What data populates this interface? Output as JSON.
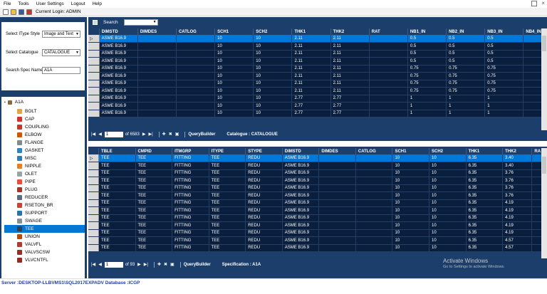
{
  "menu": [
    "File",
    "Tools",
    "User Settings",
    "Logout",
    "Help"
  ],
  "toolbar": {
    "login": "Current Login: ADMIN"
  },
  "filters": {
    "style_label": "Select IType Style",
    "style_value": "Image and Text",
    "catalogue_label": "Select Catalogue",
    "catalogue_value": "CATALOGUE",
    "spec_label": "Search Spec Name:",
    "spec_value": "A1A"
  },
  "tree": {
    "root": "A1A",
    "items": [
      {
        "label": "BOLT",
        "color": "#e8a33a"
      },
      {
        "label": "CAP",
        "color": "#d2342a"
      },
      {
        "label": "COUPLING",
        "color": "#c0392b"
      },
      {
        "label": "ELBOW",
        "color": "#d35400"
      },
      {
        "label": "FLANGE",
        "color": "#7f8c8d"
      },
      {
        "label": "GASKET",
        "color": "#2e86c1"
      },
      {
        "label": "MISC",
        "color": "#2980b9"
      },
      {
        "label": "NIPPLE",
        "color": "#e67e22"
      },
      {
        "label": "OLET",
        "color": "#95a5a6"
      },
      {
        "label": "PIPE",
        "color": "#e74c3c"
      },
      {
        "label": "PLUG",
        "color": "#a93226"
      },
      {
        "label": "REDUCER",
        "color": "#5d6d7e"
      },
      {
        "label": "RSETON_BR",
        "color": "#cb4335"
      },
      {
        "label": "SUPPORT",
        "color": "#2874a6"
      },
      {
        "label": "SWAGE",
        "color": "#839192"
      },
      {
        "label": "TEE",
        "color": "#2e4053"
      },
      {
        "label": "UNION",
        "color": "#ba4a00"
      },
      {
        "label": "VALVFL",
        "color": "#b03a2e"
      },
      {
        "label": "VALVSCSW",
        "color": "#943126"
      },
      {
        "label": "VLVCNTFL",
        "color": "#922b21"
      }
    ],
    "selected_index": 15
  },
  "grid1": {
    "search_label": "Search",
    "columns": [
      "DIMSTD",
      "DIMDES",
      "CATLOG",
      "SCH1",
      "SCH2",
      "THK1",
      "THK2",
      "RAT",
      "NB1_IN",
      "NB2_IN",
      "NB3_IN",
      "NB4_IN"
    ],
    "rows": [
      [
        "ASME B16.9",
        "",
        "",
        "10",
        "10",
        "2.11",
        "2.11",
        "",
        "0.5",
        "0.5",
        "0.5",
        ""
      ],
      [
        "ASME B16.9",
        "",
        "",
        "10",
        "10",
        "2.11",
        "2.11",
        "",
        "0.5",
        "0.5",
        "0.5",
        ""
      ],
      [
        "ASME B16.9",
        "",
        "",
        "10",
        "10",
        "2.11",
        "2.11",
        "",
        "0.5",
        "0.5",
        "0.5",
        ""
      ],
      [
        "ASME B16.9",
        "",
        "",
        "10",
        "10",
        "2.11",
        "2.11",
        "",
        "0.5",
        "0.5",
        "0.5",
        ""
      ],
      [
        "ASME B16.9",
        "",
        "",
        "10",
        "10",
        "2.11",
        "2.11",
        "",
        "0.75",
        "0.75",
        "0.75",
        ""
      ],
      [
        "ASME B16.9",
        "",
        "",
        "10",
        "10",
        "2.11",
        "2.11",
        "",
        "0.75",
        "0.75",
        "0.75",
        ""
      ],
      [
        "ASME B16.9",
        "",
        "",
        "10",
        "10",
        "2.11",
        "2.11",
        "",
        "0.75",
        "0.75",
        "0.75",
        ""
      ],
      [
        "ASME B16.9",
        "",
        "",
        "10",
        "10",
        "2.11",
        "2.11",
        "",
        "0.75",
        "0.75",
        "0.75",
        ""
      ],
      [
        "ASME B16.9",
        "",
        "",
        "10",
        "10",
        "2.77",
        "2.77",
        "",
        "1",
        "1",
        "1",
        ""
      ],
      [
        "ASME B16.9",
        "",
        "",
        "10",
        "10",
        "2.77",
        "2.77",
        "",
        "1",
        "1",
        "1",
        ""
      ],
      [
        "ASME B16.9",
        "",
        "",
        "10",
        "10",
        "2.77",
        "2.77",
        "",
        "1",
        "1",
        "1",
        ""
      ]
    ],
    "nav": {
      "position": "1",
      "of": "of 6583",
      "builder": "QueryBuilder",
      "info": "Catalogue : CATALOGUE"
    }
  },
  "grid2": {
    "columns": [
      "TBLE",
      "CMPID",
      "ITMGRP",
      "ITYPE",
      "STYPE",
      "DIMSTD",
      "DIMDES",
      "CATLOG",
      "SCH1",
      "SCH2",
      "THK1",
      "THK2",
      "RA"
    ],
    "rows": [
      [
        "TEE",
        "TEE",
        "FITTING",
        "TEE",
        "REDU",
        "ASME B16.9",
        "",
        "",
        "10",
        "10",
        "6.35",
        "3.40",
        ""
      ],
      [
        "TEE",
        "TEE",
        "FITTING",
        "TEE",
        "REDU",
        "ASME B16.9",
        "",
        "",
        "10",
        "10",
        "6.35",
        "3.40",
        ""
      ],
      [
        "TEE",
        "TEE",
        "FITTING",
        "TEE",
        "REDU",
        "ASME B16.9",
        "",
        "",
        "10",
        "10",
        "6.35",
        "3.76",
        ""
      ],
      [
        "TEE",
        "TEE",
        "FITTING",
        "TEE",
        "REDU",
        "ASME B16.9",
        "",
        "",
        "10",
        "10",
        "6.35",
        "3.76",
        ""
      ],
      [
        "TEE",
        "TEE",
        "FITTING",
        "TEE",
        "REDU",
        "ASME B16.9",
        "",
        "",
        "10",
        "10",
        "6.35",
        "3.76",
        ""
      ],
      [
        "TEE",
        "TEE",
        "FITTING",
        "TEE",
        "REDU",
        "ASME B16.9",
        "",
        "",
        "10",
        "10",
        "6.35",
        "3.76",
        ""
      ],
      [
        "TEE",
        "TEE",
        "FITTING",
        "TEE",
        "REDU",
        "ASME B16.9",
        "",
        "",
        "10",
        "10",
        "6.35",
        "4.19",
        ""
      ],
      [
        "TEE",
        "TEE",
        "FITTING",
        "TEE",
        "REDU",
        "ASME B16.9",
        "",
        "",
        "10",
        "10",
        "6.35",
        "4.19",
        ""
      ],
      [
        "TEE",
        "TEE",
        "FITTING",
        "TEE",
        "REDU",
        "ASME B16.9",
        "",
        "",
        "10",
        "10",
        "6.35",
        "4.19",
        ""
      ],
      [
        "TEE",
        "TEE",
        "FITTING",
        "TEE",
        "REDU",
        "ASME B16.9",
        "",
        "",
        "10",
        "10",
        "6.35",
        "4.19",
        ""
      ],
      [
        "TEE",
        "TEE",
        "FITTING",
        "TEE",
        "REDU",
        "ASME B16.9",
        "",
        "",
        "10",
        "10",
        "6.35",
        "4.19",
        ""
      ],
      [
        "TEE",
        "TEE",
        "FITTING",
        "TEE",
        "REDU",
        "ASME B16.9",
        "",
        "",
        "10",
        "10",
        "6.35",
        "4.57",
        ""
      ],
      [
        "TEE",
        "TEE",
        "FITTING",
        "TEE",
        "REDU",
        "ASME B16.9",
        "",
        "",
        "10",
        "10",
        "6.35",
        "4.57",
        ""
      ]
    ],
    "nav": {
      "position": "1",
      "of": "of 93",
      "builder": "QueryBuilder",
      "info": "Specification : A1A"
    }
  },
  "status": "Server :DESKTOP-LLBVMS1\\SQL2017EXPADV Database :ICGP",
  "watermark": {
    "line1": "Activate Windows",
    "line2": "Go to Settings to activate Windows."
  }
}
